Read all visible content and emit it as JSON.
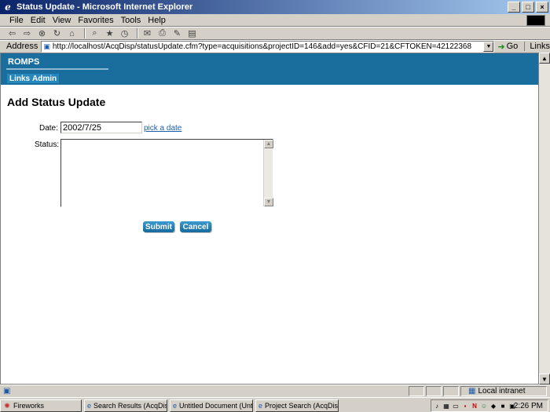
{
  "window": {
    "title": "Status Update - Microsoft Internet Explorer",
    "icon": "ie-icon",
    "controls": [
      "minimize-icon",
      "maximize-icon",
      "close-icon"
    ]
  },
  "menubar": {
    "items": [
      {
        "label": "File",
        "accel": "F"
      },
      {
        "label": "Edit",
        "accel": "E"
      },
      {
        "label": "View",
        "accel": "V"
      },
      {
        "label": "Favorites",
        "accel": "a"
      },
      {
        "label": "Tools",
        "accel": "T"
      },
      {
        "label": "Help",
        "accel": "H"
      }
    ]
  },
  "toolbar": {
    "icons": [
      "back-icon",
      "forward-icon",
      "stop-icon",
      "refresh-icon",
      "home-icon",
      "search-icon",
      "favorites-icon",
      "history-icon",
      "mail-icon",
      "print-icon",
      "edit-icon",
      "discuss-icon"
    ]
  },
  "addressbar": {
    "label": "Address",
    "url": "http://localhost/AcqDisp/statusUpdate.cfm?type=acquisitions&projectID=146&add=yes&CFID=21&CFTOKEN=42122368",
    "go_label": "Go",
    "links_label": "Links"
  },
  "site": {
    "brand": "ROMPS",
    "nav": [
      {
        "label": "Links"
      },
      {
        "label": "Admin"
      }
    ]
  },
  "form": {
    "title": "Add Status Update",
    "date_label": "Date:",
    "date_value": "2002/7/25",
    "pick_date_link": "pick a date",
    "status_label": "Status:",
    "status_value": "",
    "submit_label": "Submit",
    "cancel_label": "Cancel"
  },
  "statusbar": {
    "zone": "Local intranet"
  },
  "taskbar": {
    "tasks": [
      {
        "label": "Fireworks",
        "icon": "fireworks-icon"
      },
      {
        "label": "Search Results (AcqDisp/...",
        "icon": "ie-icon"
      },
      {
        "label": "Untitled Document (Untitle...",
        "icon": "ie-icon"
      },
      {
        "label": "Project Search (AcqDisp/...",
        "icon": "ie-icon"
      }
    ],
    "clock": "2:26 PM"
  },
  "colors": {
    "site_header": "#1a6e9e",
    "nav_tab": "#2687bd",
    "button": "#156a9e",
    "link": "#1f5fae",
    "titlebar": "#0a246a"
  }
}
